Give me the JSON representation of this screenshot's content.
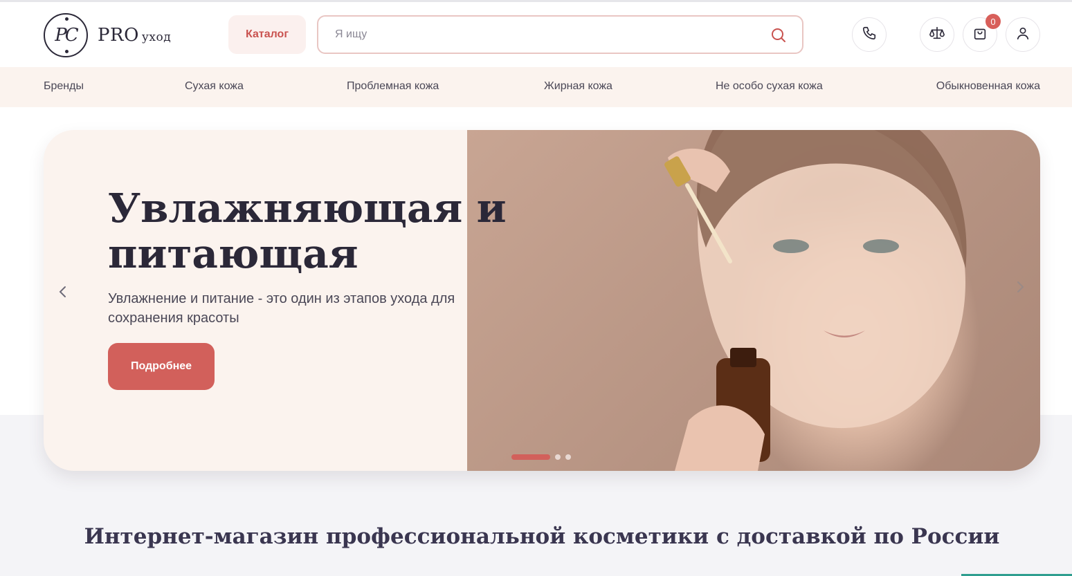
{
  "header": {
    "logo": {
      "brand": "PRO",
      "suffix": "уход"
    },
    "catalog_label": "Каталог",
    "search": {
      "placeholder": "Я ищу",
      "value": ""
    },
    "cart_count": "0"
  },
  "icons": {
    "search": "search-icon",
    "phone": "phone-icon",
    "compare": "scales-icon",
    "cart": "shopping-bag-icon",
    "account": "user-icon",
    "prev": "chevron-left-icon",
    "next": "chevron-right-icon"
  },
  "categories": [
    "Бренды",
    "Сухая кожа",
    "Проблемная кожа",
    "Жирная кожа",
    "Не особо сухая кожа",
    "Обыкновенная кожа"
  ],
  "hero": {
    "title_line1": "Увлажняющая и",
    "title_line2": "питающая",
    "subtitle": "Увлажнение и питание - это один из этапов ухода для сохранения красоты",
    "button_label": "Подробнее",
    "slides_total": 3,
    "active_slide": 1
  },
  "section_title": "Интернет-магазин профессиональной косметики с доставкой по России",
  "colors": {
    "accent": "#d2605b",
    "nav_bg": "#fbf3ee",
    "text_dark": "#2b2838"
  }
}
